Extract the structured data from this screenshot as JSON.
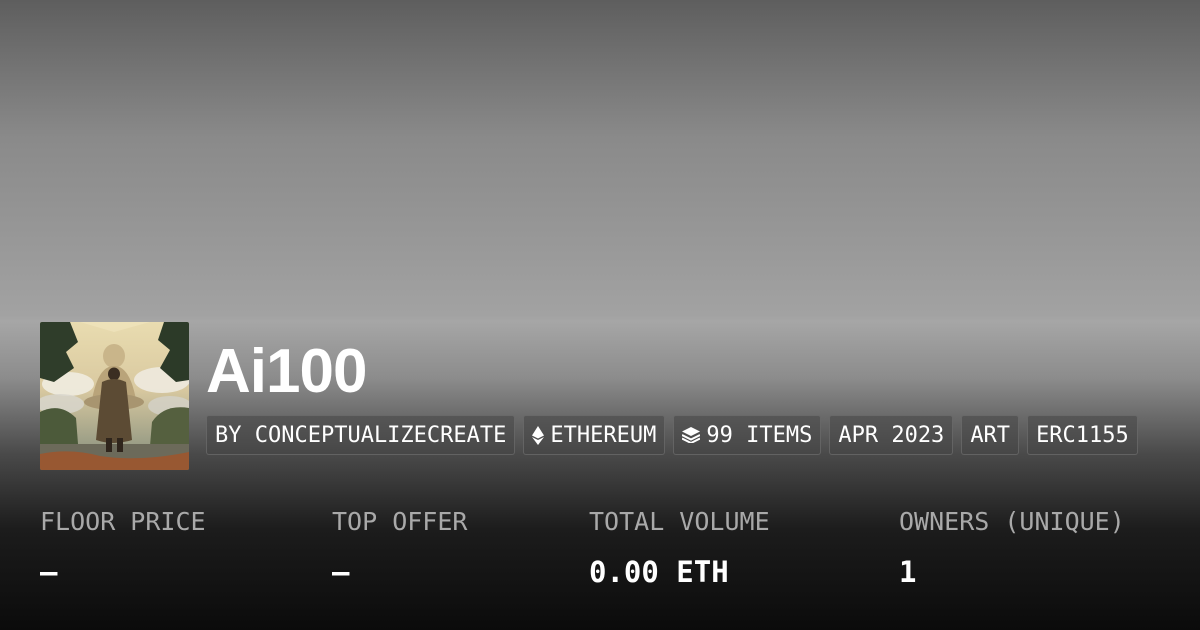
{
  "collection": {
    "name": "Ai100",
    "image_alt": "Monk standing before a giant seated Buddha in a misty landscape"
  },
  "chips": [
    {
      "label": "BY CONCEPTUALIZECREATE",
      "icon": ""
    },
    {
      "label": "ETHEREUM",
      "icon": "ethereum-icon"
    },
    {
      "label": "99 ITEMS",
      "icon": "layers-icon"
    },
    {
      "label": "APR 2023",
      "icon": ""
    },
    {
      "label": "ART",
      "icon": ""
    },
    {
      "label": "ERC1155",
      "icon": ""
    }
  ],
  "stats": [
    {
      "label": "FLOOR PRICE",
      "value": "–"
    },
    {
      "label": "TOP OFFER",
      "value": "–"
    },
    {
      "label": "TOTAL VOLUME",
      "value": "0.00 ETH"
    },
    {
      "label": "OWNERS (UNIQUE)",
      "value": "1"
    }
  ]
}
